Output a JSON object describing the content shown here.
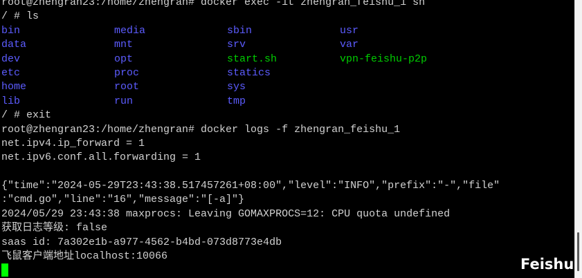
{
  "terminal": {
    "lines_before_ls": [
      "root@zhengran23:/home/zhengran# docker exec -it zhengran_feishu_1 sh",
      "/ # ls"
    ],
    "ls_rows": [
      [
        {
          "text": "bin",
          "kind": "dir"
        },
        {
          "text": "media",
          "kind": "dir"
        },
        {
          "text": "sbin",
          "kind": "dir"
        },
        {
          "text": "usr",
          "kind": "dir"
        }
      ],
      [
        {
          "text": "data",
          "kind": "dir"
        },
        {
          "text": "mnt",
          "kind": "dir"
        },
        {
          "text": "srv",
          "kind": "dir"
        },
        {
          "text": "var",
          "kind": "dir"
        }
      ],
      [
        {
          "text": "dev",
          "kind": "dir"
        },
        {
          "text": "opt",
          "kind": "dir"
        },
        {
          "text": "start.sh",
          "kind": "exe"
        },
        {
          "text": "vpn-feishu-p2p",
          "kind": "exe"
        }
      ],
      [
        {
          "text": "etc",
          "kind": "dir"
        },
        {
          "text": "proc",
          "kind": "dir"
        },
        {
          "text": "statics",
          "kind": "dir"
        }
      ],
      [
        {
          "text": "home",
          "kind": "dir"
        },
        {
          "text": "root",
          "kind": "dir"
        },
        {
          "text": "sys",
          "kind": "dir"
        }
      ],
      [
        {
          "text": "lib",
          "kind": "dir"
        },
        {
          "text": "run",
          "kind": "dir"
        },
        {
          "text": "tmp",
          "kind": "dir"
        }
      ]
    ],
    "lines_after_ls": [
      "/ # exit",
      "root@zhengran23:/home/zhengran# docker logs -f zhengran_feishu_1",
      "net.ipv4.ip_forward = 1",
      "net.ipv6.conf.all.forwarding = 1",
      "",
      "{\"time\":\"2024-05-29T23:43:38.517457261+08:00\",\"level\":\"INFO\",\"prefix\":\"-\",\"file\"",
      ":\"cmd.go\",\"line\":\"16\",\"message\":\"[-a]\"}",
      "2024/05/29 23:43:38 maxprocs: Leaving GOMAXPROCS=12: CPU quota undefined",
      "获取日志等级: false",
      "saas id: 7a302e1b-a977-4562-b4bd-073d8773e4db",
      "飞鼠客户端地址localhost:10066"
    ]
  },
  "watermark": {
    "text": "Feishu"
  },
  "colors": {
    "background": "#000000",
    "text": "#d2d2d2",
    "directory": "#5c5cff",
    "executable": "#00cd00",
    "cursor": "#00ff00"
  }
}
